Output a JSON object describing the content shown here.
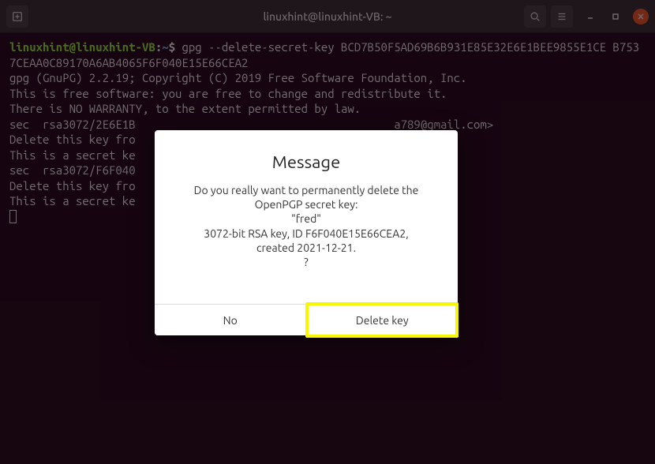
{
  "titlebar": {
    "title": "linuxhint@linuxhint-VB: ~"
  },
  "prompt": {
    "user_host": "linuxhint@linuxhint-VB",
    "sep1": ":",
    "path": "~",
    "sep2": "$ "
  },
  "terminal": {
    "command": "gpg --delete-secret-key BCD7B50F5AD69B6B931E85E32E6E1BEE9855E1CE B7537CEAA0C89170A6AB4065F6F040E15E66CEA2",
    "lines": [
      "gpg (GnuPG) 2.2.19; Copyright (C) 2019 Free Software Foundation, Inc.",
      "This is free software: you are free to change and redistribute it.",
      "There is NO WARRANTY, to the extent permitted by law.",
      "",
      "sec  rsa3072/2E6E1B                                       a789@gmail.com>",
      "",
      "Delete this key fro",
      "This is a secret ke",
      "",
      "sec  rsa3072/F6F040",
      "",
      "Delete this key fro",
      "This is a secret ke"
    ]
  },
  "dialog": {
    "title": "Message",
    "line1": "Do you really want to permanently delete the",
    "line2": "OpenPGP secret key:",
    "line3": "\"fred\"",
    "line4": "3072-bit RSA key, ID F6F040E15E66CEA2,",
    "line5": "created 2021-12-21.",
    "line6": "?",
    "no_label": "No",
    "delete_label": "Delete key"
  }
}
